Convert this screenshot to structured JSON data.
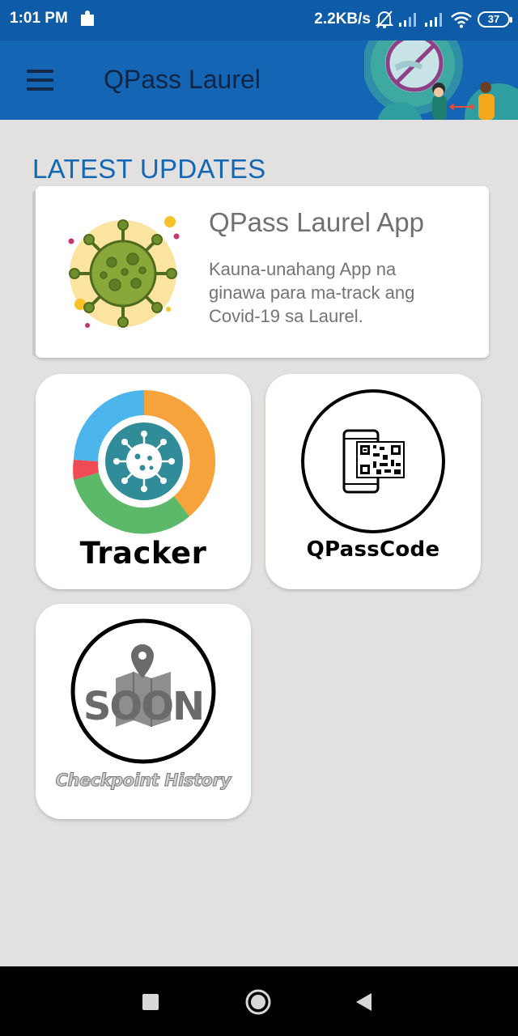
{
  "status_bar": {
    "time": "1:01 PM",
    "speed": "2.2KB/s",
    "battery": "37",
    "icons": [
      "puzzle-icon",
      "bell-off-icon",
      "signal-icon",
      "signal-icon",
      "wifi-icon",
      "battery-icon"
    ]
  },
  "app_bar": {
    "title": "QPass Laurel",
    "menu_icon": "hamburger-menu-icon",
    "background_color": "#1565b5"
  },
  "section": {
    "title": "LATEST UPDATES"
  },
  "update_card": {
    "title": "QPass Laurel App",
    "description": "Kauna-unahang App na ginawa para ma-track ang Covid-19 sa Laurel.",
    "image_icon": "virus-icon"
  },
  "tiles": [
    {
      "label": "Tracker",
      "icon": "donut-chart-virus-icon"
    },
    {
      "label": "QPassCode",
      "icon": "phone-qr-code-icon"
    },
    {
      "overlay": "SOON",
      "label": "Checkpoint History",
      "icon": "map-pin-icon"
    }
  ],
  "nav_bar": {
    "buttons": [
      "recents-square-icon",
      "home-circle-icon",
      "back-triangle-icon"
    ]
  },
  "colors": {
    "accent": "#1467b5",
    "status_bar": "#0e5ba8",
    "background": "#e2e1e0"
  }
}
